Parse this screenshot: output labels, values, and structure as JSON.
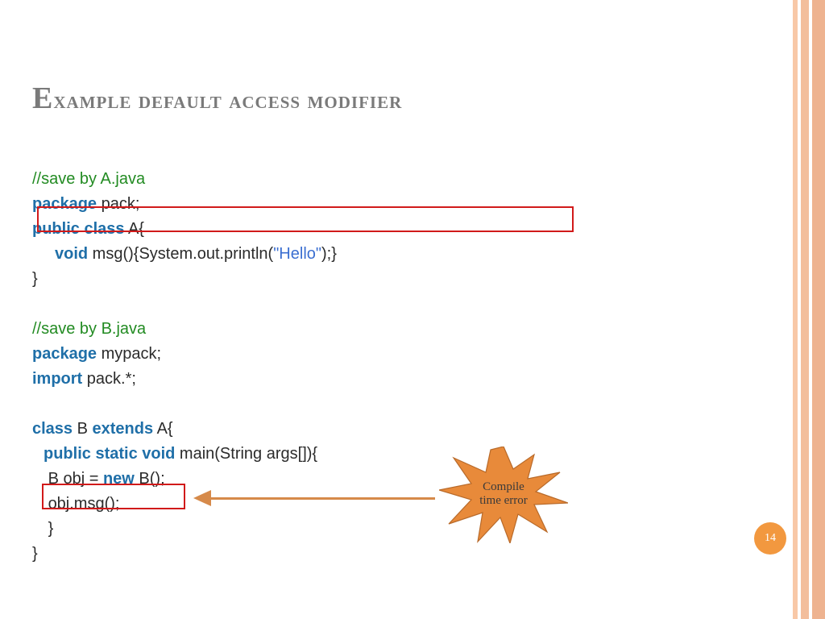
{
  "title": "Example default access modifier",
  "code": {
    "a_comment": "//save by A.java",
    "a_pkg_kw": "package",
    "a_pkg": " pack;",
    "a_cls_kw": "public class",
    "a_cls": " A{",
    "a_msg_kw": "void",
    "a_msg_1": " msg(){System.out.println(",
    "a_msg_str": "\"Hello\"",
    "a_msg_2": ");}",
    "a_close": "}",
    "b_comment": "//save by B.java",
    "b_pkg_kw": "package",
    "b_pkg": " mypack;",
    "b_imp_kw": "import",
    "b_imp": " pack.*;",
    "b_cls_kw1": "class",
    "b_cls_1": " B ",
    "b_cls_kw2": "extends",
    "b_cls_2": " A{",
    "b_main_kw": "public static void",
    "b_main": " main(String args[]){",
    "b_obj_1": "B obj = ",
    "b_obj_kw": "new",
    "b_obj_2": " B();",
    "b_call": "obj.msg();",
    "b_close1": "}",
    "b_close2": "}"
  },
  "callout": {
    "line1": "Compile",
    "line2": "time error"
  },
  "page_number": "14"
}
